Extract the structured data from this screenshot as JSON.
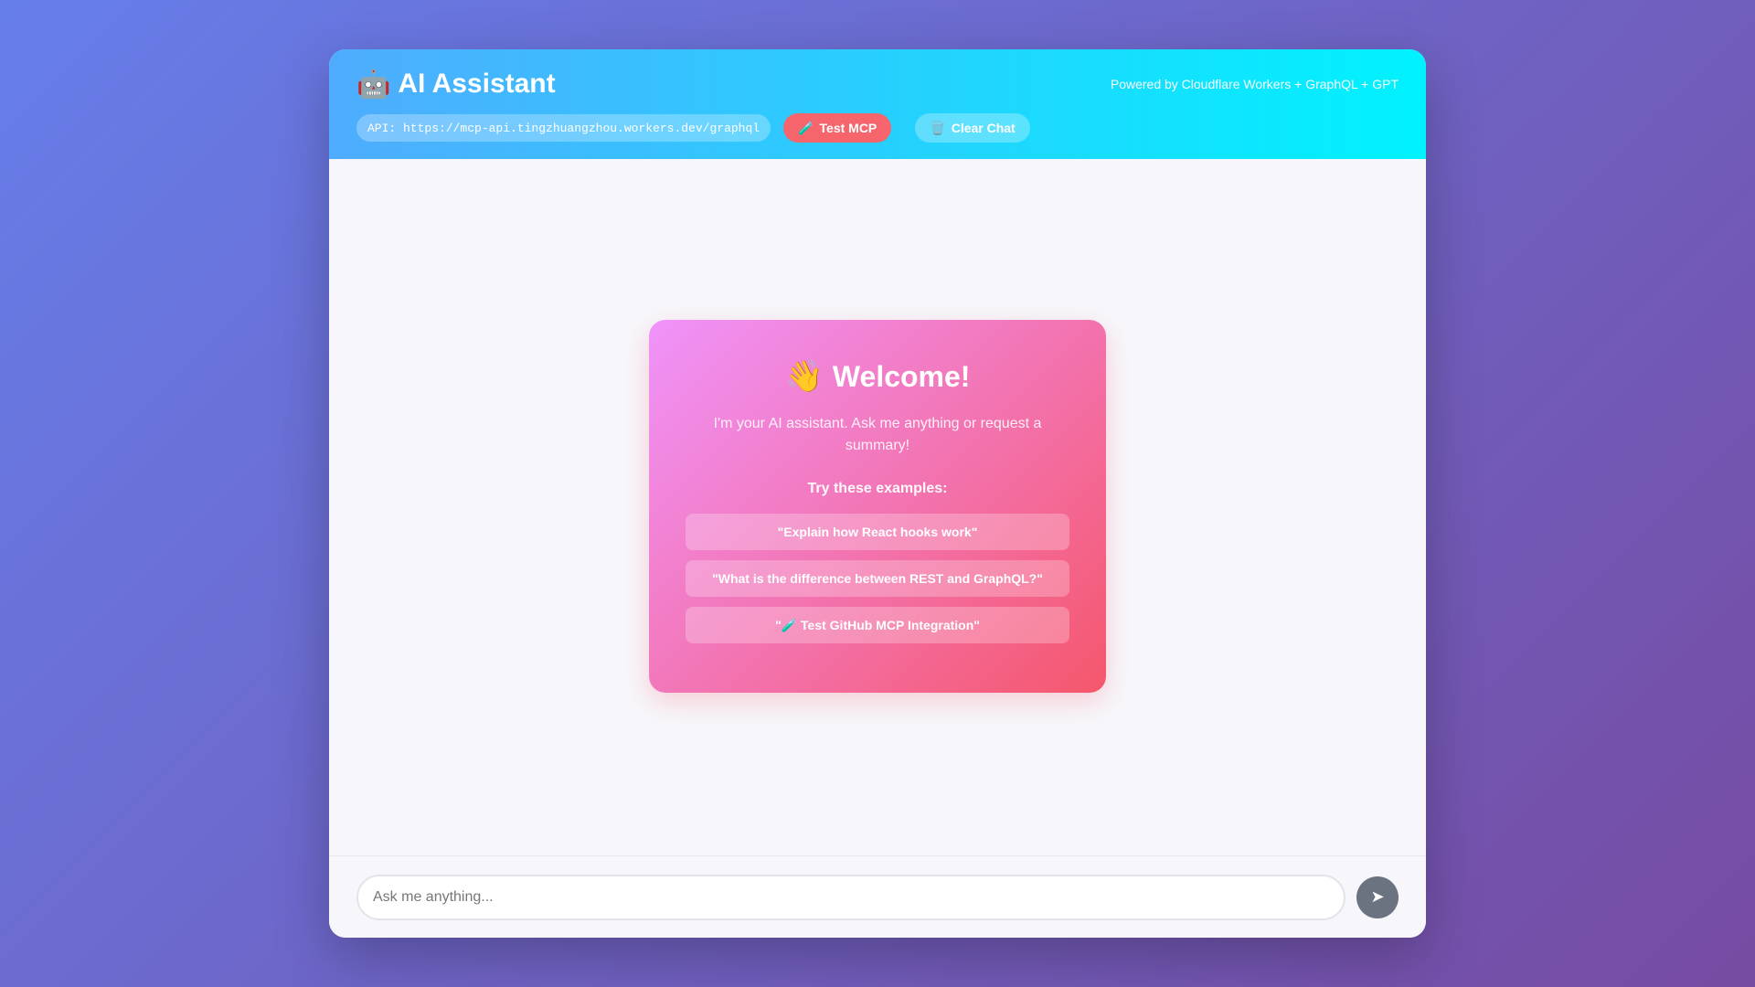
{
  "header": {
    "robot_icon": "🤖",
    "title": "AI Assistant",
    "powered_by": "Powered by Cloudflare Workers + GraphQL + GPT",
    "api_label": "API: https://mcp-api.tingzhuangzhou.workers.dev/graphql",
    "test_mcp_icon": "🧪",
    "test_mcp_label": "Test MCP",
    "clear_chat_icon": "🗑️",
    "clear_chat_label": "Clear Chat"
  },
  "welcome": {
    "wave_icon": "👋",
    "title": "Welcome!",
    "text": "I'm your AI assistant. Ask me anything or request a summary!",
    "try_label": "Try these examples:",
    "examples": [
      "\"Explain how React hooks work\"",
      "\"What is the difference between REST and GraphQL?\"",
      "\"🧪 Test GitHub MCP Integration\""
    ]
  },
  "input": {
    "placeholder": "Ask me anything...",
    "value": "",
    "send_icon": "➤"
  },
  "colors": {
    "background_start": "#667eea",
    "background_end": "#764ba2",
    "header_start": "#4facfe",
    "header_end": "#00f2fe",
    "card_start": "#f093fb",
    "card_end": "#f5576c",
    "test_button": "#f5656b",
    "send_button": "#6b7280"
  }
}
